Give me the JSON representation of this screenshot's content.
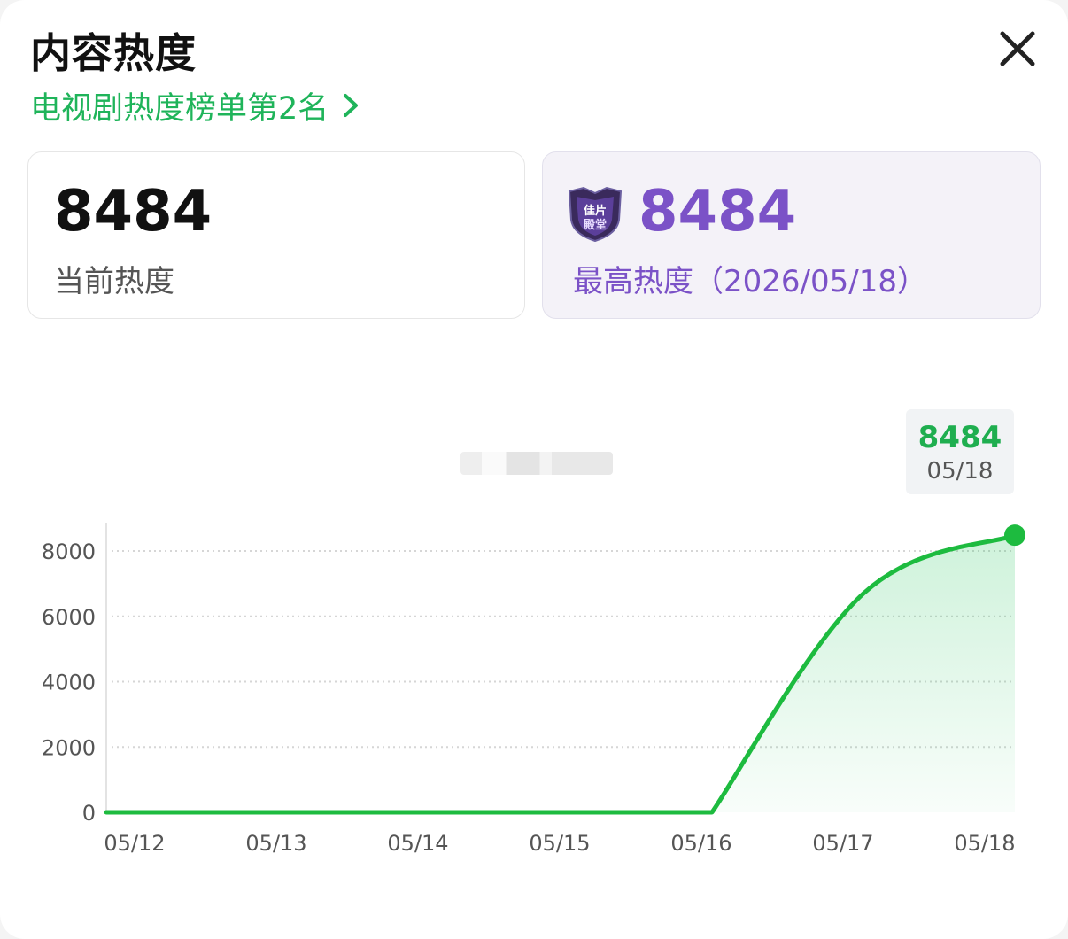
{
  "header": {
    "title": "内容热度",
    "rank_link": "电视剧热度榜单第2名"
  },
  "current": {
    "value": "8484",
    "label": "当前热度"
  },
  "peak": {
    "value": "8484",
    "label": "最高热度",
    "date": "（2026/05/18）",
    "badge_text": [
      "佳片",
      "殿堂"
    ]
  },
  "tooltip": {
    "value": "8484",
    "date": "05/18"
  },
  "colors": {
    "accent": "#1fb45a",
    "peak": "#7b52c7",
    "line": "#1dbb3f"
  },
  "chart_data": {
    "type": "area",
    "title": "",
    "xlabel": "",
    "ylabel": "",
    "x": [
      "05/12",
      "05/13",
      "05/14",
      "05/15",
      "05/16",
      "05/17",
      "05/18"
    ],
    "series": [
      {
        "values": [
          0,
          0,
          0,
          0,
          0,
          6700,
          8484
        ]
      }
    ],
    "yticks": [
      0,
      2000,
      4000,
      6000,
      8000
    ],
    "ylim": [
      0,
      8484
    ],
    "grid": true,
    "highlight": {
      "x": "05/18",
      "y": 8484
    }
  }
}
